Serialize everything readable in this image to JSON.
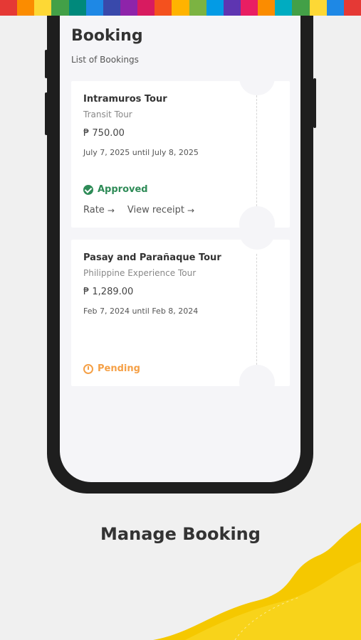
{
  "banner": {
    "colors": [
      "#e53935",
      "#fb8c00",
      "#fdd835",
      "#43a047",
      "#00897b",
      "#1e88e5",
      "#3949ab",
      "#8e24aa",
      "#d81b60",
      "#f4511e",
      "#ffb300",
      "#7cb342",
      "#039be5",
      "#5e35b1",
      "#e91e63",
      "#fb8c00",
      "#00acc1",
      "#43a047",
      "#fdd835",
      "#1e88e5",
      "#e53935"
    ]
  },
  "screen": {
    "title": "Booking",
    "subtitle": "List of Bookings"
  },
  "bookings": [
    {
      "name": "Intramuros Tour",
      "type": "Transit Tour",
      "price": "₱ 750.00",
      "dates": "July 7, 2025 until July 8, 2025",
      "status": "Approved",
      "rate_label": "Rate",
      "receipt_label": "View receipt"
    },
    {
      "name": "Pasay and Parañaque Tour",
      "type": "Philippine Experience Tour",
      "price": "₱ 1,289.00",
      "dates": "Feb 7, 2024 until Feb 8, 2024",
      "status": "Pending"
    }
  ],
  "caption": "Manage Booking",
  "colors": {
    "approved": "#2e8b57",
    "pending": "#f5a046",
    "accent_wave": "#f5c800"
  }
}
